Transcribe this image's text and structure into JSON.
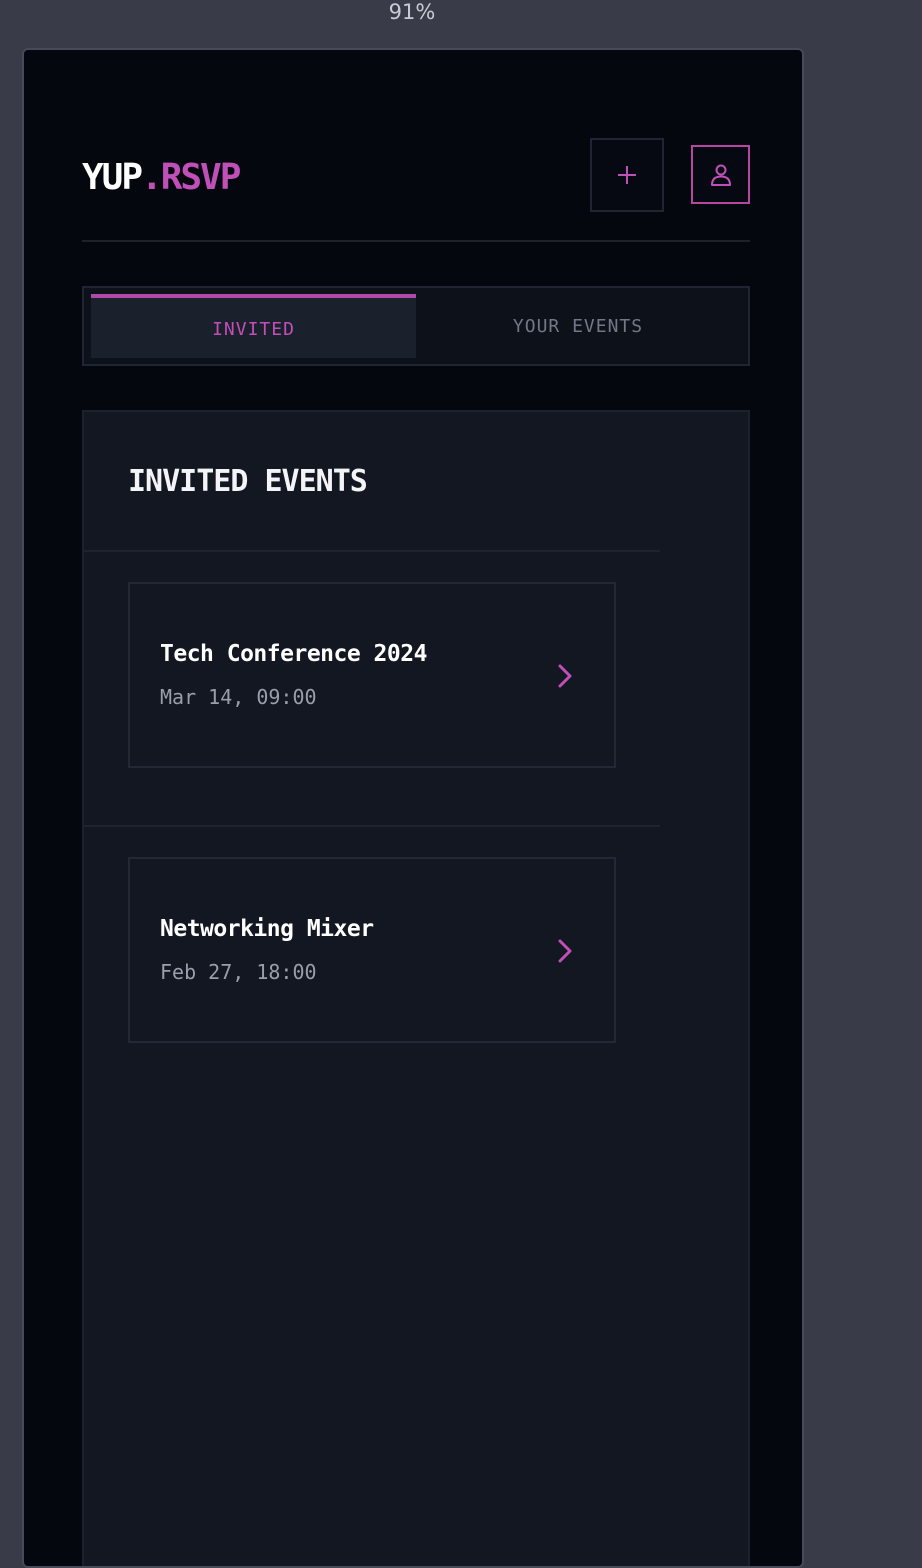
{
  "zoom": "91%",
  "logo": {
    "primary": "YUP",
    "accent": ".RSVP"
  },
  "header": {
    "add_icon": "plus-icon",
    "profile_icon": "user-icon"
  },
  "tabs": [
    {
      "label": "INVITED",
      "active": true
    },
    {
      "label": "YOUR EVENTS",
      "active": false
    }
  ],
  "panel": {
    "title": "INVITED EVENTS",
    "events": [
      {
        "name": "Tech Conference 2024",
        "date": "Mar 14, 09:00",
        "icon": "chevron-right-icon"
      },
      {
        "name": "Networking Mixer",
        "date": "Feb 27, 18:00",
        "icon": "chevron-right-icon"
      }
    ]
  },
  "colors": {
    "accent": "#c04fb8",
    "background": "#05070f",
    "panel": "#131722",
    "outer": "#393b48"
  }
}
